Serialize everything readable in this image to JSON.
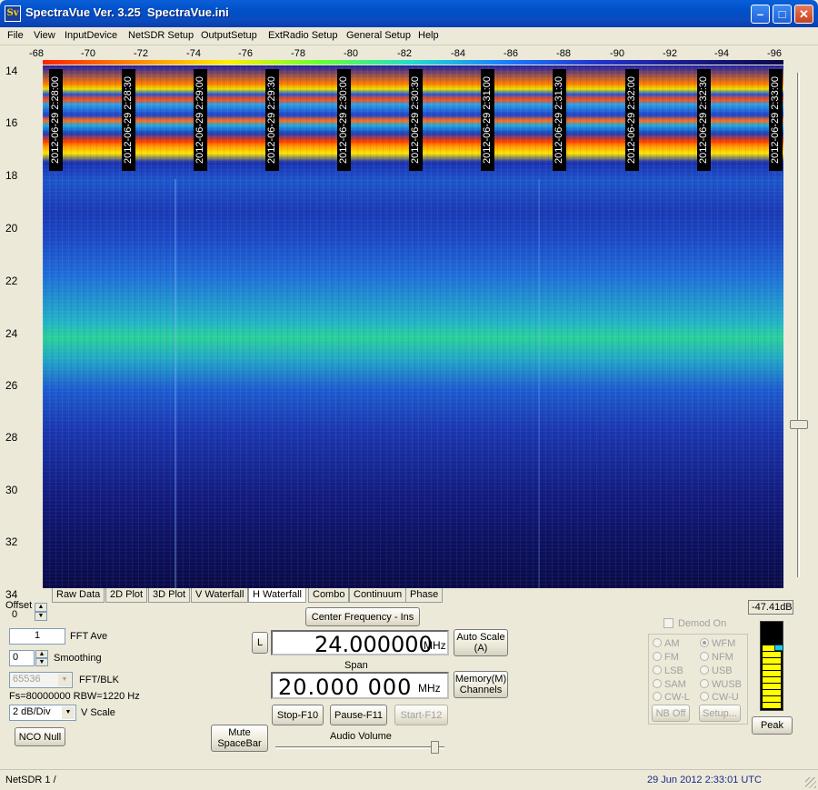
{
  "window": {
    "title": "SpectraVue Ver. 3.25  SpectraVue.ini",
    "icon": "Sv",
    "controls": [
      "minimize",
      "maximize",
      "close"
    ]
  },
  "menu": [
    "File",
    "View",
    "InputDevice",
    "NetSDR Setup",
    "OutputSetup",
    "ExtRadio Setup",
    "General Setup",
    "Help"
  ],
  "freq_axis": [
    "-68",
    "-70",
    "-72",
    "-74",
    "-76",
    "-78",
    "-80",
    "-82",
    "-84",
    "-86",
    "-88",
    "-90",
    "-92",
    "-94",
    "-96"
  ],
  "time_axis": [
    "14",
    "16",
    "18",
    "20",
    "22",
    "24",
    "26",
    "28",
    "30",
    "32",
    "34"
  ],
  "timestamps": [
    "2012-06-29 2:28:00",
    "2012-06-29 2:28:30",
    "2012-06-29 2:29:00",
    "2012-06-29 2:29:30",
    "2012-06-29 2:30:00",
    "2012-06-29 2:30:30",
    "2012-06-29 2:31:00",
    "2012-06-29 2:31:30",
    "2012-06-29 2:32:00",
    "2012-06-29 2:32:30",
    "2012-06-29 2:33:00"
  ],
  "tabs": [
    "Raw Data",
    "2D Plot",
    "3D Plot",
    "V Waterfall",
    "H Waterfall",
    "Combo",
    "Continuum",
    "Phase"
  ],
  "active_tab": "H Waterfall",
  "controls": {
    "offset_label": "Offset",
    "offset_value": "0",
    "fft_ave_value": "1",
    "fft_ave_label": "FFT Ave",
    "smoothing_value": "0",
    "smoothing_label": "Smoothing",
    "fft_blk_value": "65536",
    "fft_blk_label": "FFT/BLK",
    "fs_info": "Fs=80000000 RBW=1220 Hz",
    "vscale_value": "2 dB/Div",
    "vscale_label": "V Scale",
    "nco_null": "NCO Null",
    "mute": "Mute\nSpaceBar",
    "center_freq_btn": "Center Frequency - Ins",
    "l_btn": "L",
    "center_freq": "24.000000",
    "center_unit": "MHz",
    "auto_scale": "Auto Scale\n(A)",
    "span_label": "Span",
    "span_freq": "20.000 000",
    "span_unit": "MHz",
    "memory": "Memory(M)\nChannels",
    "stop": "Stop-F10",
    "pause": "Pause-F11",
    "start": "Start-F12",
    "audio_volume": "Audio Volume"
  },
  "demod": {
    "title": "Demod On",
    "modes": [
      "AM",
      "WFM",
      "FM",
      "NFM",
      "LSB",
      "USB",
      "SAM",
      "WUSB",
      "CW-L",
      "CW-U"
    ],
    "selected": "WFM",
    "nb_off": "NB Off",
    "setup": "Setup..."
  },
  "meter": {
    "level": "-47.41dB",
    "fill_fraction": 0.72,
    "peak_label": "Peak"
  },
  "status": {
    "left": "NetSDR 1  /",
    "right": "29 Jun 2012  2:33:01 UTC"
  },
  "colors": {
    "titlebar": "#0a5fd8",
    "status_text": "#1a2a8c",
    "meter_fill": "#ffff00"
  }
}
